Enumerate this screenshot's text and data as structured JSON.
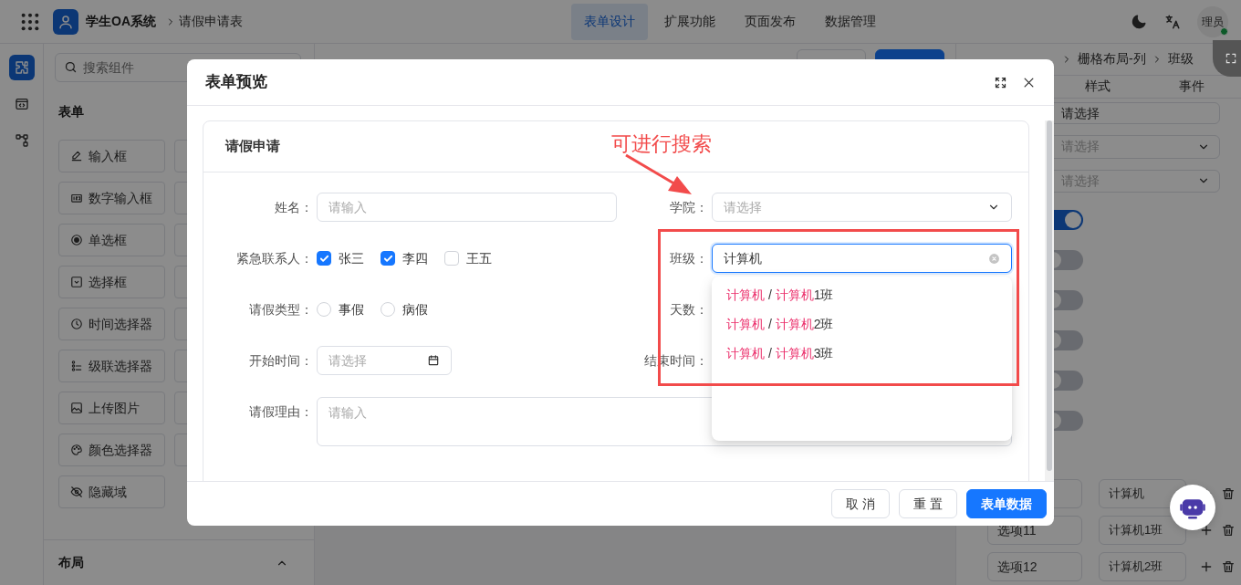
{
  "header": {
    "app_name": "学生OA系统",
    "breadcrumb": "请假申请表",
    "nav": [
      {
        "label": "表单设计",
        "selected": true
      },
      {
        "label": "扩展功能",
        "selected": false
      },
      {
        "label": "页面发布",
        "selected": false
      },
      {
        "label": "数据管理",
        "selected": false
      }
    ],
    "avatar": {
      "text": "理员",
      "online": true
    }
  },
  "rail": [
    {
      "kind": "components",
      "selected": true
    },
    {
      "kind": "code",
      "selected": false
    },
    {
      "kind": "flow",
      "selected": false
    }
  ],
  "component_panel": {
    "search_placeholder": "搜索组件",
    "sections": [
      {
        "title": "表单",
        "items": [
          {
            "label": "输入框",
            "kind": "input"
          },
          {
            "label": "数字输入框",
            "kind": "number"
          },
          {
            "label": "单选框",
            "kind": "radio"
          },
          {
            "label": "选择框",
            "kind": "select"
          },
          {
            "label": "时间选择器",
            "kind": "time"
          },
          {
            "label": "级联选择器",
            "kind": "cascader"
          },
          {
            "label": "上传图片",
            "kind": "image"
          },
          {
            "label": "颜色选择器",
            "kind": "color"
          },
          {
            "label": "隐藏域",
            "kind": "hidden"
          }
        ]
      },
      {
        "title": "布局",
        "expanded": true
      }
    ]
  },
  "properties_panel": {
    "breadcrumb": [
      "栅格布局-列",
      "班级"
    ],
    "tabs": [
      {
        "label": "样式",
        "selected": false
      },
      {
        "label": "事件",
        "selected": false
      }
    ],
    "default_value": "请选择",
    "selects": [
      {
        "placeholder": "请选择"
      },
      {
        "placeholder": "请选择"
      }
    ],
    "toggles": [
      {
        "on": true
      },
      {
        "on": false
      },
      {
        "on": false
      },
      {
        "on": false
      },
      {
        "on": false
      },
      {
        "on": false
      }
    ],
    "options": [
      {
        "value": "计算机"
      },
      {
        "label": "选项11",
        "value": "计算机1班"
      },
      {
        "label": "选项12",
        "value": "计算机2班"
      }
    ]
  },
  "modal": {
    "title": "表单预览",
    "form": {
      "title": "请假申请",
      "fields": [
        {
          "kind": "input",
          "label": "姓名：",
          "placeholder": "请输入"
        },
        {
          "kind": "select",
          "label": "学院：",
          "placeholder": "请选择"
        },
        {
          "kind": "checkbox",
          "label": "紧急联系人：",
          "options": [
            {
              "label": "张三",
              "checked": true
            },
            {
              "label": "李四",
              "checked": true
            },
            {
              "label": "王五",
              "checked": false
            }
          ]
        },
        {
          "kind": "cascader",
          "label": "班级：",
          "value": "计算机",
          "focused": true
        },
        {
          "kind": "radio",
          "label": "请假类型：",
          "options": [
            {
              "label": "事假",
              "selected": false
            },
            {
              "label": "病假",
              "selected": false
            }
          ]
        },
        {
          "kind": "covered",
          "label": "天数："
        },
        {
          "kind": "date",
          "label": "开始时间：",
          "placeholder": "请选择"
        },
        {
          "kind": "covered",
          "label": "结束时间："
        },
        {
          "kind": "textarea",
          "label": "请假理由：",
          "placeholder": "请输入"
        }
      ]
    },
    "suggestions": [
      {
        "parts": [
          {
            "text": "计算机",
            "match": true
          },
          {
            "text": " / ",
            "match": false
          },
          {
            "text": "计算机",
            "match": true
          },
          {
            "text": "1班",
            "match": false
          }
        ]
      },
      {
        "parts": [
          {
            "text": "计算机",
            "match": true
          },
          {
            "text": " / ",
            "match": false
          },
          {
            "text": "计算机",
            "match": true
          },
          {
            "text": "2班",
            "match": false
          }
        ]
      },
      {
        "parts": [
          {
            "text": "计算机",
            "match": true
          },
          {
            "text": " / ",
            "match": false
          },
          {
            "text": "计算机",
            "match": true
          },
          {
            "text": "3班",
            "match": false
          }
        ]
      }
    ],
    "buttons": [
      {
        "label": "取 消",
        "kind": "default"
      },
      {
        "label": "重 置",
        "kind": "default"
      },
      {
        "label": "表单数据",
        "kind": "primary"
      }
    ]
  },
  "annotation": {
    "text": "可进行搜索"
  }
}
